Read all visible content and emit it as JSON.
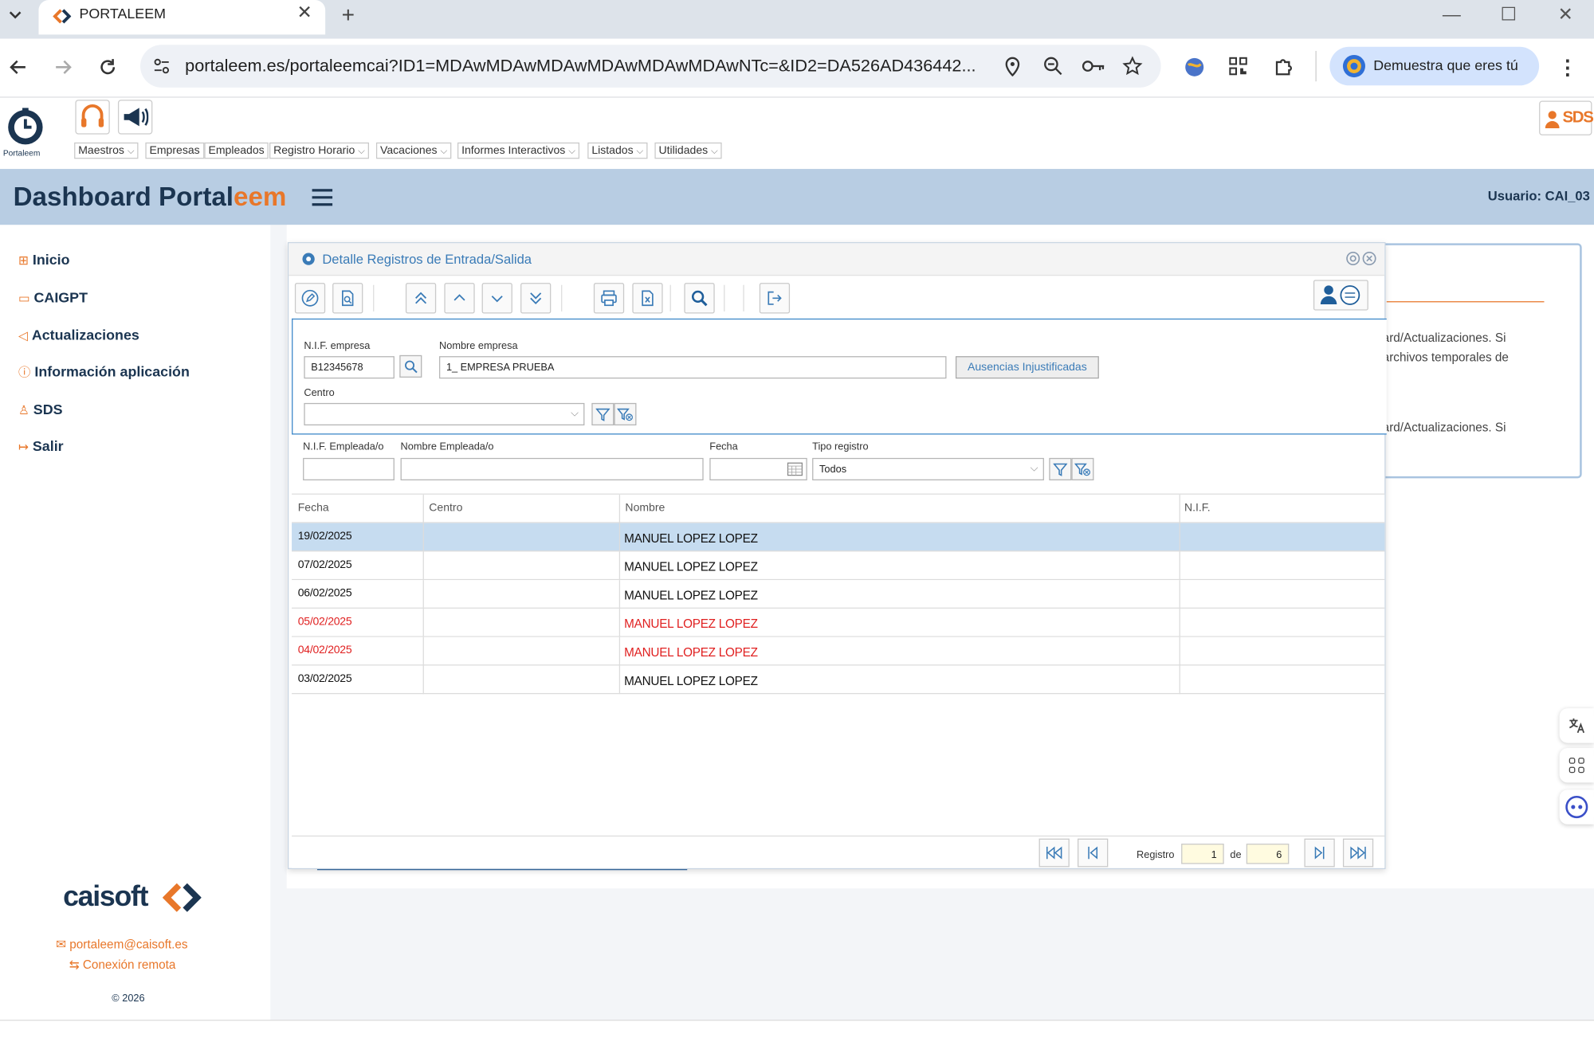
{
  "browser": {
    "tab_title": "PORTALEEM",
    "url": "portaleem.es/portaleemcai?ID1=MDAwMDAwMDAwMDAwMDAwMDAwNTc=&ID2=DA526AD436442...",
    "profile_label": "Demuestra que eres tú"
  },
  "app": {
    "logo_label": "Portaleem",
    "sds_badge": "SDS",
    "menu": [
      "Maestros",
      "Empresas",
      "Empleados",
      "Registro Horario",
      "Vacaciones",
      "Informes Interactivos",
      "Listados",
      "Utilidades"
    ],
    "title_main": "Dashboard",
    "title_port": "Portal",
    "title_eem": "eem",
    "user_label": "Usuario: CAI_03"
  },
  "sidebar": {
    "items": [
      {
        "label": "Inicio",
        "icon": "grid-icon"
      },
      {
        "label": "CAIGPT",
        "icon": "chat-icon"
      },
      {
        "label": "Actualizaciones",
        "icon": "megaphone-icon"
      },
      {
        "label": "Información aplicación",
        "icon": "info-icon"
      },
      {
        "label": "SDS",
        "icon": "user-icon"
      },
      {
        "label": "Salir",
        "icon": "logout-icon"
      }
    ],
    "brand": "caisoft",
    "email": "portaleem@caisoft.es",
    "remote": "Conexión remota",
    "copyright": "© 2026"
  },
  "background_panel": {
    "line1": "ard/Actualizaciones. Si",
    "line2": "archivos temporales de",
    "line3": "ard/Actualizaciones. Si"
  },
  "modal": {
    "title": "Detalle Registros de Entrada/Salida",
    "filters": {
      "nif_empresa_label": "N.I.F. empresa",
      "nif_empresa_value": "B12345678",
      "nombre_empresa_label": "Nombre empresa",
      "nombre_empresa_value": "1_       EMPRESA PRUEBA",
      "ausencias_button": "Ausencias Injustificadas",
      "centro_label": "Centro",
      "centro_value": "",
      "nif_empleado_label": "N.I.F. Empleada/o",
      "nombre_empleado_label": "Nombre Empleada/o",
      "fecha_label": "Fecha",
      "tipo_registro_label": "Tipo registro",
      "tipo_registro_value": "Todos"
    },
    "columns": [
      "Fecha",
      "Centro",
      "Nombre",
      "N.I.F."
    ],
    "rows": [
      {
        "fecha": "19/02/2025",
        "centro": "",
        "nombre": "MANUEL LOPEZ LOPEZ",
        "nif": "",
        "selected": true,
        "highlight": false
      },
      {
        "fecha": "07/02/2025",
        "centro": "",
        "nombre": "MANUEL LOPEZ LOPEZ",
        "nif": "",
        "selected": false,
        "highlight": false
      },
      {
        "fecha": "06/02/2025",
        "centro": "",
        "nombre": "MANUEL LOPEZ LOPEZ",
        "nif": "",
        "selected": false,
        "highlight": false
      },
      {
        "fecha": "05/02/2025",
        "centro": "",
        "nombre": "MANUEL LOPEZ LOPEZ",
        "nif": "",
        "selected": false,
        "highlight": true
      },
      {
        "fecha": "04/02/2025",
        "centro": "",
        "nombre": "MANUEL LOPEZ LOPEZ",
        "nif": "",
        "selected": false,
        "highlight": true
      },
      {
        "fecha": "03/02/2025",
        "centro": "",
        "nombre": "MANUEL LOPEZ LOPEZ",
        "nif": "",
        "selected": false,
        "highlight": false
      }
    ],
    "pager": {
      "registro_label": "Registro",
      "current": "1",
      "de_label": "de",
      "total": "6"
    }
  },
  "colors": {
    "brand_orange": "#e8772a",
    "brand_navy": "#1b3551",
    "banner": "#b8cde3",
    "selected_row": "#c6dcf0",
    "highlight_text": "#e02020",
    "link_blue": "#3a7bb7"
  }
}
